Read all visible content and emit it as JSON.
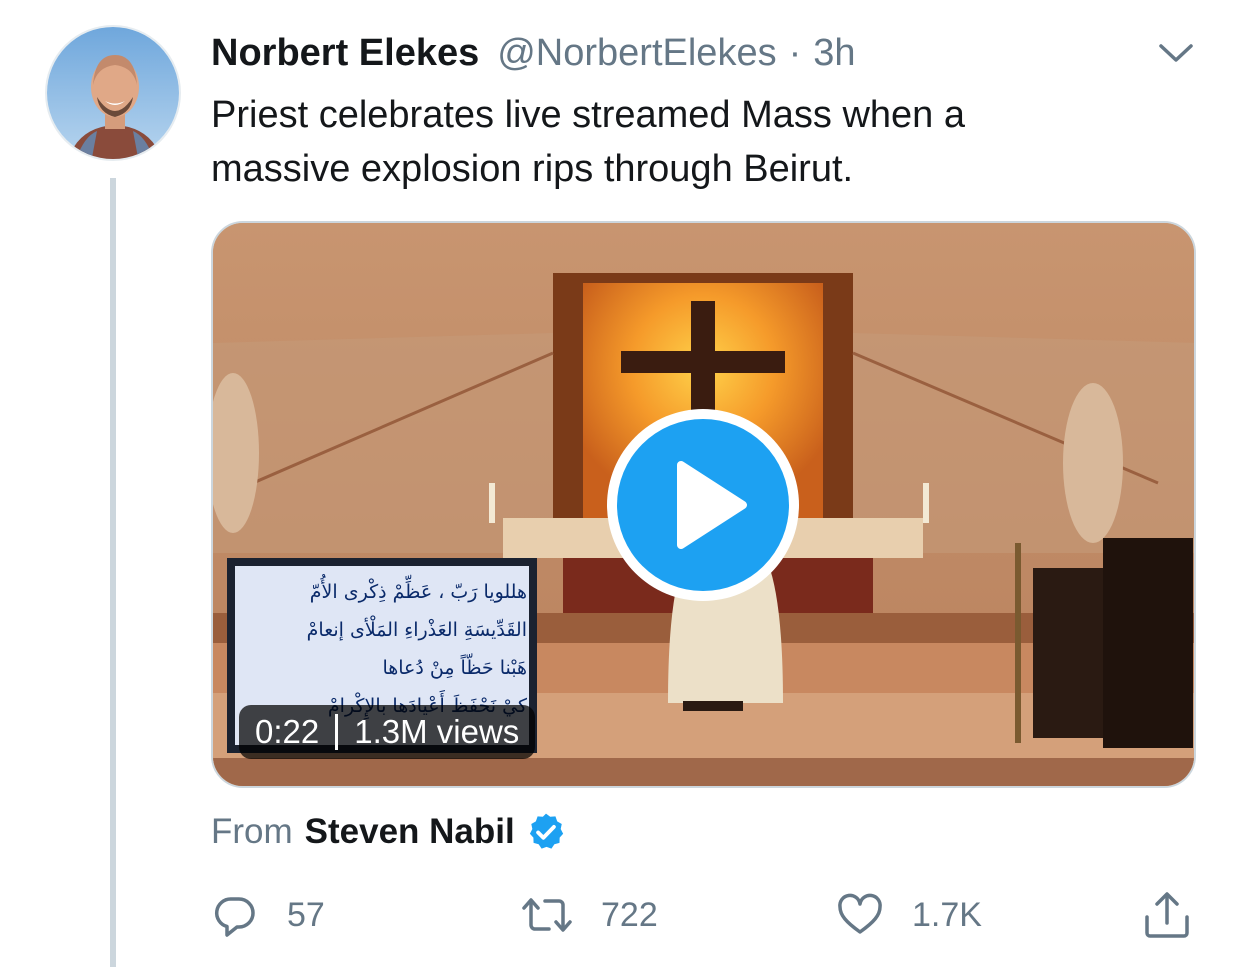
{
  "tweet": {
    "author_name": "Norbert Elekes",
    "author_handle": "@NorbertElekes",
    "separator": "·",
    "time_ago": "3h",
    "text_line1": "Priest celebrates live streamed Mass when a",
    "text_line2": "massive explosion rips through Beirut."
  },
  "video": {
    "duration": "0:22",
    "views": "1.3M views",
    "screen_text": [
      "هللويا رَبّ ، عَظِّمْ ذِكْرى الأُمّ",
      "القَدِّيسَةِ العَذْراءِ المَلْأى إنعامْ",
      "هَبْنا حَظّاً مِنْ دُعاها",
      "كيْ نَحْفَظَ أَعْيادَها بالإِكْرامْ"
    ],
    "play_icon": "play-icon"
  },
  "source": {
    "label": "From",
    "name": "Steven Nabil",
    "verified_icon": "verified-badge-icon"
  },
  "actions": {
    "replies": "57",
    "retweets": "722",
    "likes": "1.7K"
  },
  "icons": {
    "more": "chevron-down-icon",
    "reply": "reply-icon",
    "retweet": "retweet-icon",
    "like": "heart-icon",
    "share": "share-icon"
  },
  "colors": {
    "text_primary": "#14171a",
    "text_secondary": "#657786",
    "accent": "#1da1f2",
    "thread_line": "#ccd6dd"
  }
}
